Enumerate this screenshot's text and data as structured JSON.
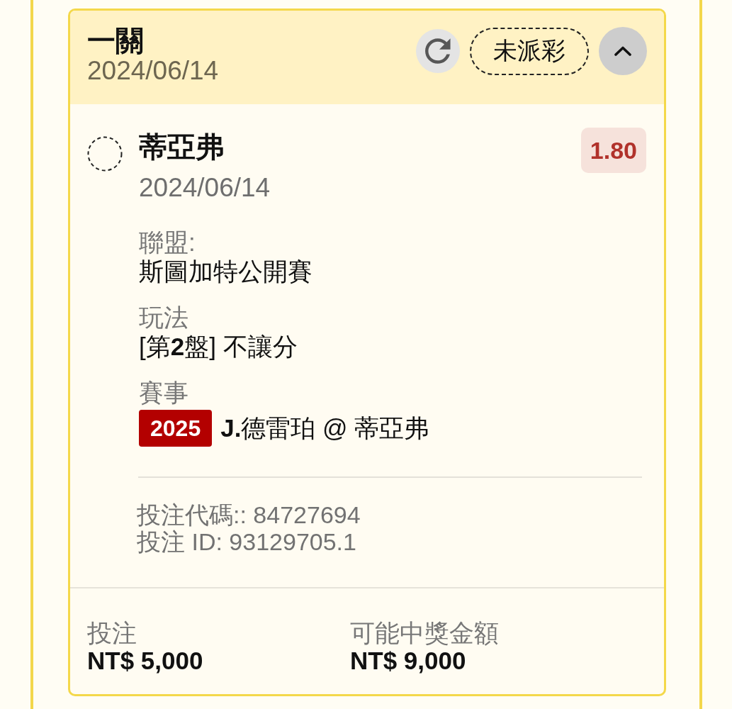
{
  "bet": {
    "title": "一關",
    "date": "2024/06/14",
    "status": {
      "label": "未派彩",
      "settled": false
    },
    "expanded": true
  },
  "legs": [
    {
      "settled": false,
      "selection": "蒂亞弗",
      "date": "2024/06/14",
      "odds": "1.80",
      "fields": [
        {
          "label": "聯盟:",
          "value": "斯圖加特公開賽"
        },
        {
          "label": "玩法",
          "value": "[第**2**盤] 不讓分"
        }
      ],
      "event": {
        "label": "賽事",
        "tag": "2025",
        "teams": "**J.**德雷珀 @ 蒂亞弗"
      }
    }
  ],
  "references": [
    "投注代碼:: 84727694",
    "投注 ID: 93129705.1"
  ],
  "summary": [
    {
      "label": "投注",
      "value": "NT$ 5,000"
    },
    {
      "label": "可能中獎金額",
      "value": "NT$ 9,000"
    }
  ]
}
